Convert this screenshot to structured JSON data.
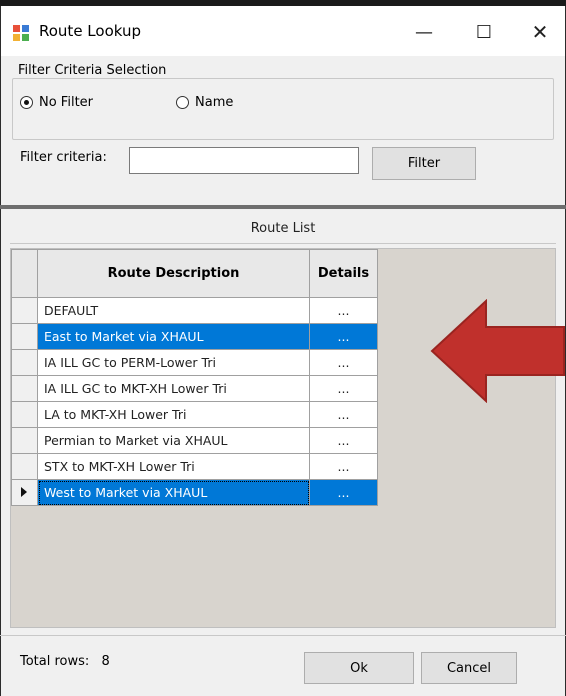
{
  "window": {
    "title": "Route Lookup",
    "minimize_glyph": "—",
    "maximize_glyph": "☐",
    "close_glyph": "✕"
  },
  "filter_group": {
    "legend": "Filter Criteria Selection",
    "options": [
      {
        "label": "No Filter",
        "selected": true
      },
      {
        "label": "Name",
        "selected": false
      }
    ]
  },
  "filter": {
    "label": "Filter criteria:",
    "value": "",
    "button_label": "Filter"
  },
  "route_list": {
    "caption": "Route List",
    "columns": [
      "Route Description",
      "Details"
    ],
    "rows": [
      {
        "description": "DEFAULT",
        "details": "...",
        "selected": false
      },
      {
        "description": "East to Market via XHAUL",
        "details": "...",
        "selected": true
      },
      {
        "description": "IA ILL GC to PERM-Lower Tri",
        "details": "...",
        "selected": false
      },
      {
        "description": "IA ILL GC to MKT-XH Lower Tri",
        "details": "...",
        "selected": false
      },
      {
        "description": "LA to MKT-XH Lower Tri",
        "details": "...",
        "selected": false
      },
      {
        "description": "Permian to Market via XHAUL",
        "details": "...",
        "selected": false
      },
      {
        "description": "STX to MKT-XH Lower Tri",
        "details": "...",
        "selected": false
      },
      {
        "description": "West to Market via XHAUL",
        "details": "...",
        "selected": true,
        "current": true
      }
    ]
  },
  "footer": {
    "total_label": "Total rows:",
    "total_value": "8",
    "ok_label": "Ok",
    "cancel_label": "Cancel"
  },
  "colors": {
    "selection": "#0078d7",
    "annotation_arrow": "#c0302c"
  }
}
